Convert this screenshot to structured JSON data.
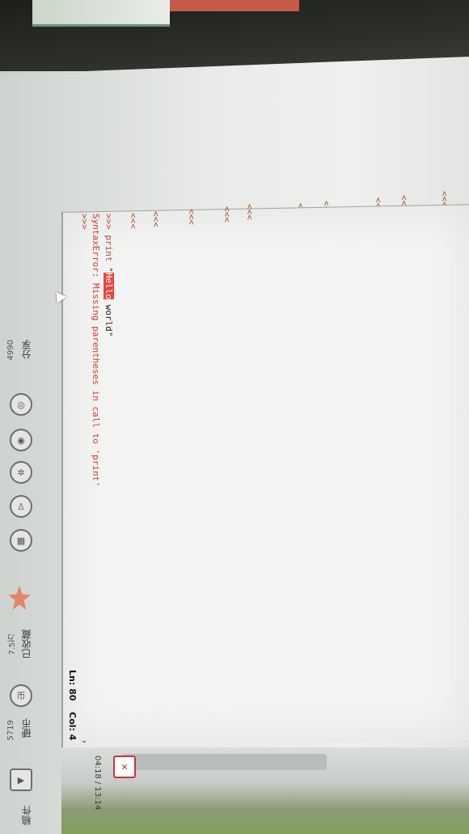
{
  "shell": {
    "prompt": ">>>",
    "command_pre": ">>> print ",
    "command_quote_open": "\"",
    "command_highlight": "Hello",
    "command_post": " world\"",
    "error_line": "SyntaxError: Missing parentheses in call to 'print'",
    "final_prompt": ">>>",
    "status_line": "Ln: 80",
    "status_col": "Col: 4"
  },
  "side_panel": {
    "share_label": "分享",
    "share_count": "4990",
    "favorite_label": "已收藏",
    "favorite_count": "7.5万",
    "coin_label": "硬币",
    "coin_count": "5719",
    "report_label": "稿件"
  },
  "bottom": {
    "time_label": "04:18 / 13:14"
  },
  "colors": {
    "prompt": "#b04a36",
    "error": "#d23b2e",
    "highlight": "#e5473f"
  }
}
